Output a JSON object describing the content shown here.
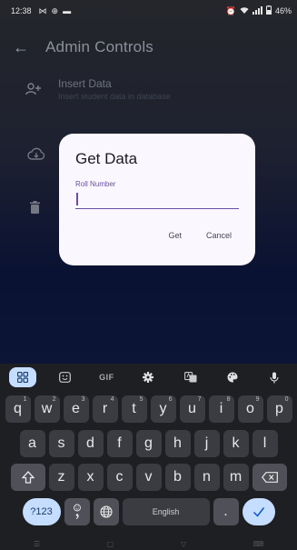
{
  "status_bar": {
    "time": "12:38",
    "battery": "46%"
  },
  "app_bar": {
    "title": "Admin Controls"
  },
  "list": {
    "items": [
      {
        "title": "Insert Data",
        "subtitle": "Insert student data in database"
      }
    ]
  },
  "dialog": {
    "title": "Get Data",
    "field_label": "Roll Number",
    "field_value": "",
    "get_label": "Get",
    "cancel_label": "Cancel"
  },
  "keyboard": {
    "toolbar": {
      "gif_label": "GIF"
    },
    "rows": [
      [
        {
          "key": "q",
          "num": "1"
        },
        {
          "key": "w",
          "num": "2"
        },
        {
          "key": "e",
          "num": "3"
        },
        {
          "key": "r",
          "num": "4"
        },
        {
          "key": "t",
          "num": "5"
        },
        {
          "key": "y",
          "num": "6"
        },
        {
          "key": "u",
          "num": "7"
        },
        {
          "key": "i",
          "num": "8"
        },
        {
          "key": "o",
          "num": "9"
        },
        {
          "key": "p",
          "num": "0"
        }
      ],
      [
        "a",
        "s",
        "d",
        "f",
        "g",
        "h",
        "j",
        "k",
        "l"
      ],
      [
        "z",
        "x",
        "c",
        "v",
        "b",
        "n",
        "m"
      ]
    ],
    "symbols_label": "?123",
    "space_label": "English",
    "period_label": "."
  },
  "colors": {
    "accent": "#6750a4",
    "keyboard_accent": "#c5ddff",
    "dialog_bg": "#fbf7ff"
  }
}
